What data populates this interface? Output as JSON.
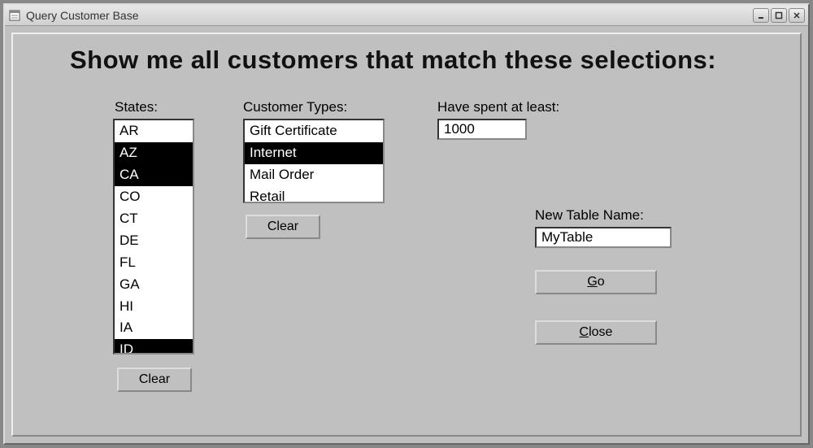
{
  "window": {
    "title": "Query Customer Base"
  },
  "heading": "Show me all customers that match these selections:",
  "states": {
    "label": "States:",
    "items": [
      "AR",
      "AZ",
      "CA",
      "CO",
      "CT",
      "DE",
      "FL",
      "GA",
      "HI",
      "IA",
      "ID"
    ],
    "selected": [
      "AZ",
      "CA",
      "ID"
    ],
    "clear_label": "Clear"
  },
  "customer_types": {
    "label": "Customer Types:",
    "items": [
      "Gift Certificate",
      "Internet",
      "Mail Order",
      "Retail"
    ],
    "selected": [
      "Internet"
    ],
    "clear_label": "Clear"
  },
  "spent": {
    "label": "Have spent at least:",
    "value": "1000"
  },
  "new_table": {
    "label": "New Table Name:",
    "value": "MyTable"
  },
  "buttons": {
    "go": "Go",
    "close": "Close"
  }
}
